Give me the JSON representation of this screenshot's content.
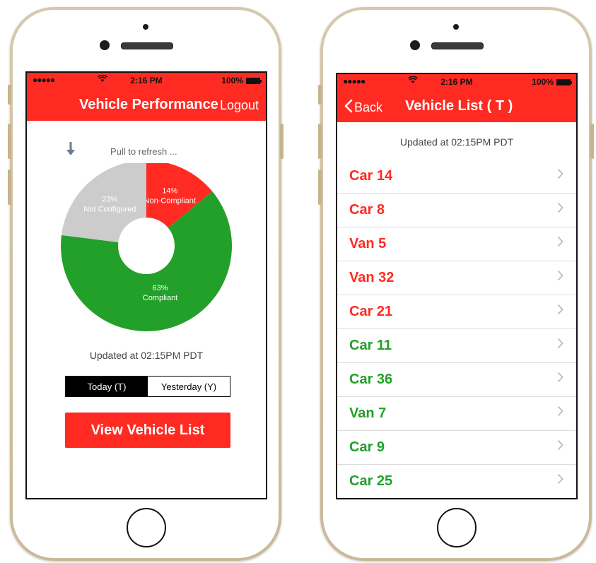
{
  "status_bar": {
    "signal": "●●●●●",
    "time": "2:16 PM",
    "battery": "100%"
  },
  "left_screen": {
    "title": "Vehicle Performance",
    "logout_label": "Logout",
    "pull_to_refresh": "Pull to refresh ...",
    "chart_data": {
      "type": "pie",
      "donut": true,
      "slices": [
        {
          "label": "Non-Compliant",
          "value": 14,
          "value_label": "14%",
          "color": "#ff2a22"
        },
        {
          "label": "Compliant",
          "value": 63,
          "value_label": "63%",
          "color": "#22a02a"
        },
        {
          "label": "Not Configured",
          "value": 23,
          "value_label": "23%",
          "color": "#cccccc"
        }
      ]
    },
    "updated_text": "Updated at 02:15PM PDT",
    "segments": [
      {
        "label": "Today (T)",
        "active": true
      },
      {
        "label": "Yesterday (Y)",
        "active": false
      }
    ],
    "view_list_button": "View Vehicle List"
  },
  "right_screen": {
    "back_label": "Back",
    "title": "Vehicle List ( T )",
    "updated_text": "Updated at 02:15PM PDT",
    "vehicles": [
      {
        "name": "Car 14",
        "status": "non-compliant"
      },
      {
        "name": "Car 8",
        "status": "non-compliant"
      },
      {
        "name": "Van 5",
        "status": "non-compliant"
      },
      {
        "name": "Van 32",
        "status": "non-compliant"
      },
      {
        "name": "Car 21",
        "status": "non-compliant"
      },
      {
        "name": "Car 11",
        "status": "compliant"
      },
      {
        "name": "Car 36",
        "status": "compliant"
      },
      {
        "name": "Van 7",
        "status": "compliant"
      },
      {
        "name": "Car 9",
        "status": "compliant"
      },
      {
        "name": "Car 25",
        "status": "compliant"
      }
    ]
  },
  "colors": {
    "brand_red": "#ff2a22",
    "compliant_green": "#22a02a",
    "not_configured_gray": "#cccccc",
    "chevron": "#bbbbbb"
  },
  "icons": {
    "back": "chevron-left-icon",
    "row_disclosure": "chevron-right-icon",
    "pull_arrow": "arrow-down-icon",
    "wifi": "wifi-icon",
    "battery": "battery-icon"
  }
}
